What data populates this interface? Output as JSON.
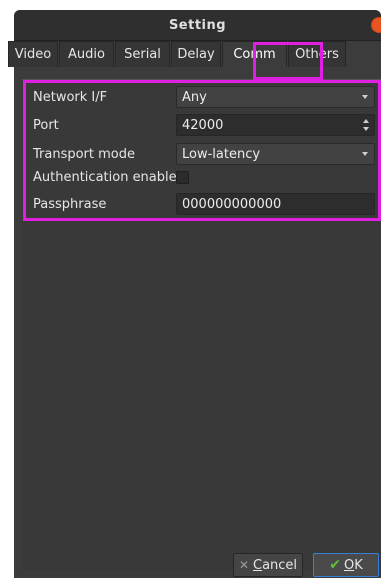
{
  "window": {
    "title": "Setting"
  },
  "tabs": [
    {
      "label": "Video",
      "active": false
    },
    {
      "label": "Audio",
      "active": false
    },
    {
      "label": "Serial",
      "active": false
    },
    {
      "label": "Delay",
      "active": false
    },
    {
      "label": "Comm",
      "active": true
    },
    {
      "label": "Others",
      "active": false
    }
  ],
  "form": {
    "network_if": {
      "label": "Network I/F",
      "value": "Any"
    },
    "port": {
      "label": "Port",
      "value": "42000"
    },
    "transport_mode": {
      "label": "Transport mode",
      "value": "Low-latency"
    },
    "auth_enable": {
      "label": "Authentication enable",
      "checked": false
    },
    "passphrase": {
      "label": "Passphrase",
      "value": "000000000000"
    }
  },
  "buttons": {
    "cancel": "Cancel",
    "ok": "OK"
  },
  "icons": {
    "cancel": "x-icon",
    "ok": "check-icon",
    "close": "close-icon"
  },
  "colors": {
    "highlight": "#e020e0",
    "close": "#e95420",
    "ok_check": "#5fbf3f"
  }
}
